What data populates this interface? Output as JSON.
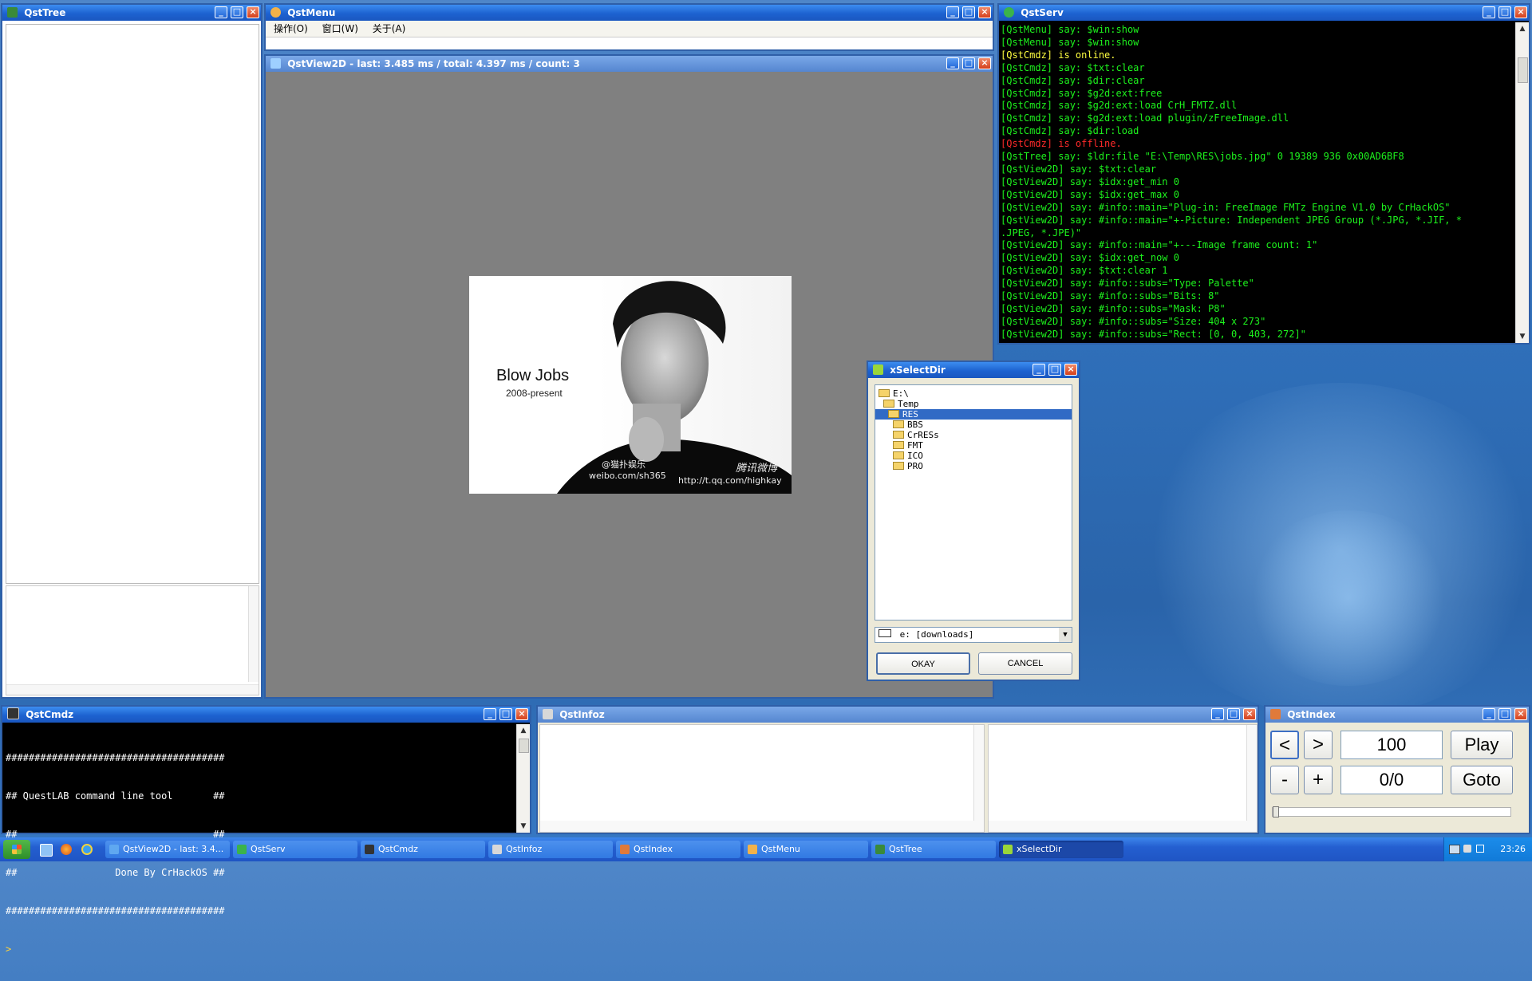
{
  "qsttree": {
    "title": "QstTree"
  },
  "qstmenu": {
    "title": "QstMenu",
    "menu": [
      "操作(O)",
      "窗口(W)",
      "关于(A)"
    ]
  },
  "qstview": {
    "title": "QstView2D - last: 3.485 ms / total: 4.397 ms / count: 3",
    "image": {
      "headline": "Blow Jobs",
      "sub": "2008-present",
      "wm1": "@猫扑娱乐",
      "wm2": "weibo.com/sh365",
      "wm3": "腾讯微博",
      "wm4": "http://t.qq.com/highkay"
    }
  },
  "qstserv": {
    "title": "QstServ",
    "lines": [
      {
        "t": "[QstMenu] say: $win:show",
        "c": "#1df21d"
      },
      {
        "t": "[QstMenu] say: $win:show",
        "c": "#1df21d"
      },
      {
        "t": "[QstCmdz] is online.",
        "c": "#ffff40"
      },
      {
        "t": "[QstCmdz] say: $txt:clear",
        "c": "#1df21d"
      },
      {
        "t": "[QstCmdz] say: $dir:clear",
        "c": "#1df21d"
      },
      {
        "t": "[QstCmdz] say: $g2d:ext:free",
        "c": "#1df21d"
      },
      {
        "t": "[QstCmdz] say: $g2d:ext:load CrH_FMTZ.dll",
        "c": "#1df21d"
      },
      {
        "t": "[QstCmdz] say: $g2d:ext:load plugin/zFreeImage.dll",
        "c": "#1df21d"
      },
      {
        "t": "[QstCmdz] say: $dir:load",
        "c": "#1df21d"
      },
      {
        "t": "[QstCmdz] is offline.",
        "c": "#ff2a2a"
      },
      {
        "t": "[QstTree] say: $ldr:file \"E:\\Temp\\RES\\jobs.jpg\" 0 19389 936 0x00AD6BF8",
        "c": "#1df21d"
      },
      {
        "t": "[QstView2D] say: $txt:clear",
        "c": "#1df21d"
      },
      {
        "t": "[QstView2D] say: $idx:get_min 0",
        "c": "#1df21d"
      },
      {
        "t": "[QstView2D] say: $idx:get_max 0",
        "c": "#1df21d"
      },
      {
        "t": "[QstView2D] say: #info::main=\"Plug-in: FreeImage FMTz Engine V1.0 by CrHackOS\"",
        "c": "#1df21d"
      },
      {
        "t": "[QstView2D] say: #info::main=\"+-Picture: Independent JPEG Group (*.JPG, *.JIF, *",
        "c": "#1df21d"
      },
      {
        "t": ".JPEG, *.JPE)\"",
        "c": "#1df21d"
      },
      {
        "t": "[QstView2D] say: #info::main=\"+---Image frame count: 1\"",
        "c": "#1df21d"
      },
      {
        "t": "[QstView2D] say: $idx:get_now 0",
        "c": "#1df21d"
      },
      {
        "t": "[QstView2D] say: $txt:clear 1",
        "c": "#1df21d"
      },
      {
        "t": "[QstView2D] say: #info::subs=\"Type: Palette\"",
        "c": "#1df21d"
      },
      {
        "t": "[QstView2D] say: #info::subs=\"Bits: 8\"",
        "c": "#1df21d"
      },
      {
        "t": "[QstView2D] say: #info::subs=\"Mask: P8\"",
        "c": "#1df21d"
      },
      {
        "t": "[QstView2D] say: #info::subs=\"Size: 404 x 273\"",
        "c": "#1df21d"
      },
      {
        "t": "[QstView2D] say: #info::subs=\"Rect: [0, 0, 403, 272]\"",
        "c": "#1df21d"
      }
    ]
  },
  "xselectdir": {
    "title": "xSelectDir",
    "tree": [
      {
        "label": "E:\\",
        "level": 0,
        "open": true,
        "selected": false
      },
      {
        "label": "Temp",
        "level": 1,
        "open": true,
        "selected": false
      },
      {
        "label": "RES",
        "level": 2,
        "open": true,
        "selected": true
      },
      {
        "label": "BBS",
        "level": 3,
        "open": false,
        "selected": false
      },
      {
        "label": "CrRESs",
        "level": 3,
        "open": false,
        "selected": false
      },
      {
        "label": "FMT",
        "level": 3,
        "open": false,
        "selected": false
      },
      {
        "label": "ICO",
        "level": 3,
        "open": false,
        "selected": false
      },
      {
        "label": "PRO",
        "level": 3,
        "open": false,
        "selected": false
      }
    ],
    "drive": "e: [downloads]",
    "ok": "OKAY",
    "cancel": "CANCEL"
  },
  "qstcmdz": {
    "title": "QstCmdz",
    "lines": [
      "######################################",
      "## QuestLAB command line tool       ##",
      "##                                  ##",
      "##                 Done By CrHackOS ##",
      "######################################"
    ],
    "prompt": ">"
  },
  "qstinfoz": {
    "title": "QstInfoz"
  },
  "qstindex": {
    "title": "QstIndex",
    "prev": "<",
    "next": ">",
    "value": "100",
    "play": "Play",
    "minus": "-",
    "plus": "+",
    "pos": "0/0",
    "goto": "Goto",
    "slider_level": 0
  },
  "taskbar": {
    "items": [
      {
        "label": "QstView2D - last: 3.4...",
        "active": false,
        "icon": "#5fa8f0"
      },
      {
        "label": "QstServ",
        "active": false,
        "icon": "#3bb34a"
      },
      {
        "label": "QstCmdz",
        "active": false,
        "icon": "#333333"
      },
      {
        "label": "QstInfoz",
        "active": false,
        "icon": "#d8d8d8"
      },
      {
        "label": "QstIndex",
        "active": false,
        "icon": "#e07a3a"
      },
      {
        "label": "QstMenu",
        "active": false,
        "icon": "#f2b24a"
      },
      {
        "label": "QstTree",
        "active": false,
        "icon": "#3a8a3a"
      },
      {
        "label": "xSelectDir",
        "active": true,
        "icon": "#9ad63a"
      }
    ],
    "clock": "23:26"
  },
  "colors": {
    "titlebar": "#1d62d0",
    "selection": "#316ac5",
    "console_green": "#1df21d",
    "desktop": "#2f6fb9"
  }
}
